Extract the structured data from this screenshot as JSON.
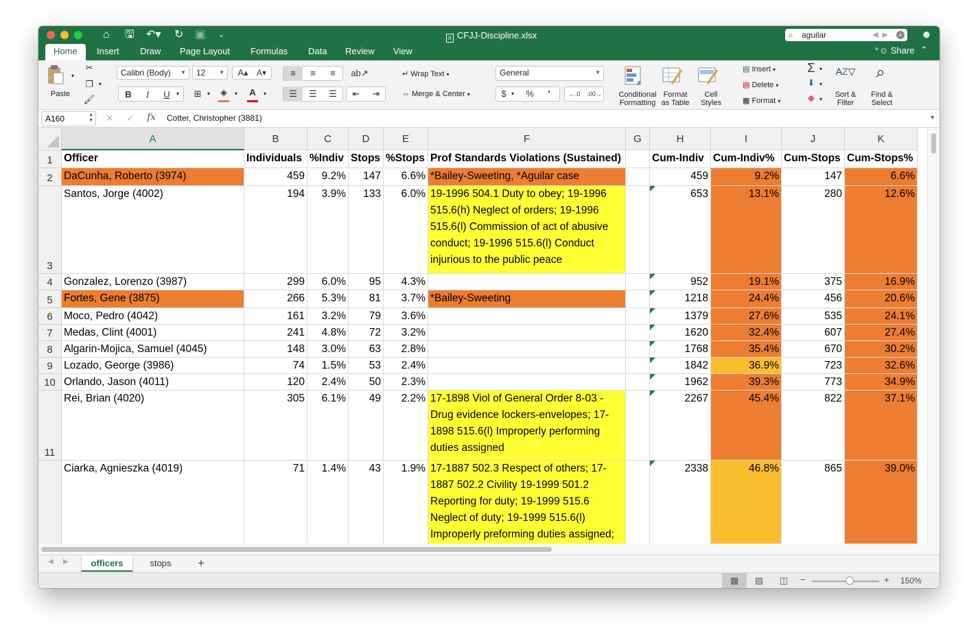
{
  "window": {
    "file_name": "CFJJ-Discipline.xlsx",
    "search_value": "aguilar"
  },
  "ribbon_tabs": [
    "Home",
    "Insert",
    "Draw",
    "Page Layout",
    "Formulas",
    "Data",
    "Review",
    "View"
  ],
  "share_label": "Share",
  "ribbon": {
    "paste": "Paste",
    "font_name": "Calibri (Body)",
    "font_size": "12",
    "bold": "B",
    "italic": "I",
    "underline": "U",
    "wrap_text": "Wrap Text",
    "merge_center": "Merge & Center",
    "number_format": "General",
    "dollar": "$",
    "percent": "%",
    "comma": "’",
    "conditional_formatting": [
      "Conditional",
      "Formatting"
    ],
    "format_as_table": [
      "Format",
      "as Table"
    ],
    "cell_styles": [
      "Cell",
      "Styles"
    ],
    "insert": "Insert",
    "delete": "Delete",
    "format": "Format",
    "sort_filter": [
      "Sort &",
      "Filter"
    ],
    "find_select": [
      "Find &",
      "Select"
    ]
  },
  "formula_bar": {
    "name_box": "A160",
    "fx": "fx",
    "content": "Cotter, Christopher (3881)"
  },
  "columns": [
    "A",
    "B",
    "C",
    "D",
    "E",
    "F",
    "G",
    "H",
    "I",
    "J",
    "K"
  ],
  "rows": [
    {
      "num": "1",
      "cells": [
        "Officer",
        "Individuals",
        "%Indiv",
        "Stops",
        "%Stops",
        "Prof Standards Violations (Sustained)",
        "",
        "Cum-Indiv",
        "Cum-Indiv%",
        "Cum-Stops",
        "Cum-Stops%"
      ]
    },
    {
      "num": "2",
      "cells": [
        "DaCunha, Roberto (3974)",
        "459",
        "9.2%",
        "147",
        "6.6%",
        "*Bailey-Sweeting, *Aguilar case",
        "",
        "459",
        "9.2%",
        "147",
        "6.6%"
      ]
    },
    {
      "num": "3",
      "cells": [
        "Santos, Jorge (4002)",
        "194",
        "3.9%",
        "133",
        "6.0%",
        "19-1996 504.1 Duty to obey; 19-1996 515.6(h) Neglect of orders; 19-1996 515.6(l) Commission of act of abusive conduct; 19-1996 515.6(l) Conduct injurious to the public peace",
        "",
        "653",
        "13.1%",
        "280",
        "12.6%"
      ]
    },
    {
      "num": "4",
      "cells": [
        "Gonzalez, Lorenzo (3987)",
        "299",
        "6.0%",
        "95",
        "4.3%",
        "",
        "",
        "952",
        "19.1%",
        "375",
        "16.9%"
      ]
    },
    {
      "num": "5",
      "cells": [
        "Fortes, Gene (3875)",
        "266",
        "5.3%",
        "81",
        "3.7%",
        "*Bailey-Sweeting",
        "",
        "1218",
        "24.4%",
        "456",
        "20.6%"
      ]
    },
    {
      "num": "6",
      "cells": [
        "Moco, Pedro (4042)",
        "161",
        "3.2%",
        "79",
        "3.6%",
        "",
        "",
        "1379",
        "27.6%",
        "535",
        "24.1%"
      ]
    },
    {
      "num": "7",
      "cells": [
        "Medas, Clint (4001)",
        "241",
        "4.8%",
        "72",
        "3.2%",
        "",
        "",
        "1620",
        "32.4%",
        "607",
        "27.4%"
      ]
    },
    {
      "num": "8",
      "cells": [
        "Algarin-Mojica, Samuel (4045)",
        "148",
        "3.0%",
        "63",
        "2.8%",
        "",
        "",
        "1768",
        "35.4%",
        "670",
        "30.2%"
      ]
    },
    {
      "num": "9",
      "cells": [
        "Lozado, George (3986)",
        "74",
        "1.5%",
        "53",
        "2.4%",
        "",
        "",
        "1842",
        "36.9%",
        "723",
        "32.6%"
      ]
    },
    {
      "num": "10",
      "cells": [
        "Orlando, Jason (4011)",
        "120",
        "2.4%",
        "50",
        "2.3%",
        "",
        "",
        "1962",
        "39.3%",
        "773",
        "34.9%"
      ]
    },
    {
      "num": "11",
      "cells": [
        "Rei, Brian (4020)",
        "305",
        "6.1%",
        "49",
        "2.2%",
        "17-1898 Viol of General Order 8-03 - Drug evidence lockers-envelopes; 17-1898 515.6(l) Improperly performing duties assigned",
        "",
        "2267",
        "45.4%",
        "822",
        "37.1%"
      ]
    },
    {
      "num": "",
      "cells": [
        "Ciarka, Agnieszka (4019)",
        "71",
        "1.4%",
        "43",
        "1.9%",
        "17-1887 502.3 Respect of others; 17-1887 502.2 Civility 19-1999 501.2 Reporting for duty; 19-1999 515.6 Neglect of duty; 19-1999 515.6(l) Improperly preforming duties assigned;",
        "",
        "2338",
        "46.8%",
        "865",
        "39.0%"
      ]
    }
  ],
  "colors": {
    "excel_green": "#207245",
    "orange_fill": "#ed7d31",
    "gold_fill": "#fbbd2e",
    "yellow_fill": "#ffff33"
  },
  "sheets": [
    "officers",
    "stops"
  ],
  "active_sheet": "officers",
  "zoom": "150%"
}
